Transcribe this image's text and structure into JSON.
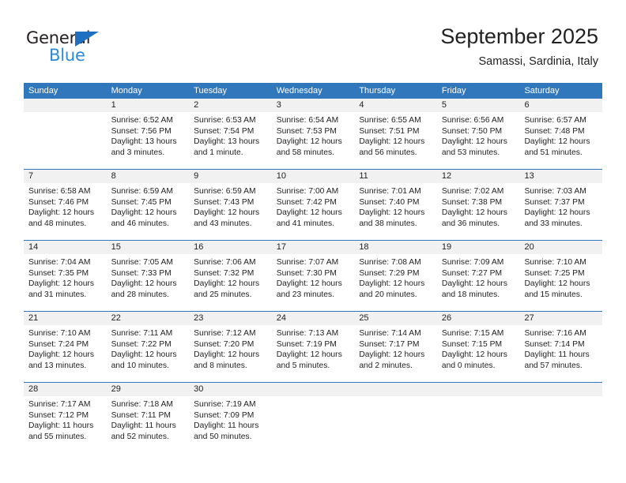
{
  "brand": {
    "name_top": "General",
    "name_bottom": "Blue",
    "triangle_icon": "triangle-icon",
    "color_dark": "#231f20",
    "color_blue": "#2e8ad6"
  },
  "header": {
    "title": "September 2025",
    "subtitle": "Samassi, Sardinia, Italy"
  },
  "theme": {
    "header_blue": "#3077bc",
    "daynum_band": "#f1f1f1",
    "text": "#222222"
  },
  "calendar": {
    "weekday_headers": [
      "Sunday",
      "Monday",
      "Tuesday",
      "Wednesday",
      "Thursday",
      "Friday",
      "Saturday"
    ],
    "labels": {
      "sunrise": "Sunrise:",
      "sunset": "Sunset:",
      "daylight": "Daylight:"
    },
    "weeks": [
      [
        {
          "day": "",
          "sunrise": "",
          "sunset": "",
          "daylight": ""
        },
        {
          "day": "1",
          "sunrise": "Sunrise: 6:52 AM",
          "sunset": "Sunset: 7:56 PM",
          "daylight": "Daylight: 13 hours and 3 minutes."
        },
        {
          "day": "2",
          "sunrise": "Sunrise: 6:53 AM",
          "sunset": "Sunset: 7:54 PM",
          "daylight": "Daylight: 13 hours and 1 minute."
        },
        {
          "day": "3",
          "sunrise": "Sunrise: 6:54 AM",
          "sunset": "Sunset: 7:53 PM",
          "daylight": "Daylight: 12 hours and 58 minutes."
        },
        {
          "day": "4",
          "sunrise": "Sunrise: 6:55 AM",
          "sunset": "Sunset: 7:51 PM",
          "daylight": "Daylight: 12 hours and 56 minutes."
        },
        {
          "day": "5",
          "sunrise": "Sunrise: 6:56 AM",
          "sunset": "Sunset: 7:50 PM",
          "daylight": "Daylight: 12 hours and 53 minutes."
        },
        {
          "day": "6",
          "sunrise": "Sunrise: 6:57 AM",
          "sunset": "Sunset: 7:48 PM",
          "daylight": "Daylight: 12 hours and 51 minutes."
        }
      ],
      [
        {
          "day": "7",
          "sunrise": "Sunrise: 6:58 AM",
          "sunset": "Sunset: 7:46 PM",
          "daylight": "Daylight: 12 hours and 48 minutes."
        },
        {
          "day": "8",
          "sunrise": "Sunrise: 6:59 AM",
          "sunset": "Sunset: 7:45 PM",
          "daylight": "Daylight: 12 hours and 46 minutes."
        },
        {
          "day": "9",
          "sunrise": "Sunrise: 6:59 AM",
          "sunset": "Sunset: 7:43 PM",
          "daylight": "Daylight: 12 hours and 43 minutes."
        },
        {
          "day": "10",
          "sunrise": "Sunrise: 7:00 AM",
          "sunset": "Sunset: 7:42 PM",
          "daylight": "Daylight: 12 hours and 41 minutes."
        },
        {
          "day": "11",
          "sunrise": "Sunrise: 7:01 AM",
          "sunset": "Sunset: 7:40 PM",
          "daylight": "Daylight: 12 hours and 38 minutes."
        },
        {
          "day": "12",
          "sunrise": "Sunrise: 7:02 AM",
          "sunset": "Sunset: 7:38 PM",
          "daylight": "Daylight: 12 hours and 36 minutes."
        },
        {
          "day": "13",
          "sunrise": "Sunrise: 7:03 AM",
          "sunset": "Sunset: 7:37 PM",
          "daylight": "Daylight: 12 hours and 33 minutes."
        }
      ],
      [
        {
          "day": "14",
          "sunrise": "Sunrise: 7:04 AM",
          "sunset": "Sunset: 7:35 PM",
          "daylight": "Daylight: 12 hours and 31 minutes."
        },
        {
          "day": "15",
          "sunrise": "Sunrise: 7:05 AM",
          "sunset": "Sunset: 7:33 PM",
          "daylight": "Daylight: 12 hours and 28 minutes."
        },
        {
          "day": "16",
          "sunrise": "Sunrise: 7:06 AM",
          "sunset": "Sunset: 7:32 PM",
          "daylight": "Daylight: 12 hours and 25 minutes."
        },
        {
          "day": "17",
          "sunrise": "Sunrise: 7:07 AM",
          "sunset": "Sunset: 7:30 PM",
          "daylight": "Daylight: 12 hours and 23 minutes."
        },
        {
          "day": "18",
          "sunrise": "Sunrise: 7:08 AM",
          "sunset": "Sunset: 7:29 PM",
          "daylight": "Daylight: 12 hours and 20 minutes."
        },
        {
          "day": "19",
          "sunrise": "Sunrise: 7:09 AM",
          "sunset": "Sunset: 7:27 PM",
          "daylight": "Daylight: 12 hours and 18 minutes."
        },
        {
          "day": "20",
          "sunrise": "Sunrise: 7:10 AM",
          "sunset": "Sunset: 7:25 PM",
          "daylight": "Daylight: 12 hours and 15 minutes."
        }
      ],
      [
        {
          "day": "21",
          "sunrise": "Sunrise: 7:10 AM",
          "sunset": "Sunset: 7:24 PM",
          "daylight": "Daylight: 12 hours and 13 minutes."
        },
        {
          "day": "22",
          "sunrise": "Sunrise: 7:11 AM",
          "sunset": "Sunset: 7:22 PM",
          "daylight": "Daylight: 12 hours and 10 minutes."
        },
        {
          "day": "23",
          "sunrise": "Sunrise: 7:12 AM",
          "sunset": "Sunset: 7:20 PM",
          "daylight": "Daylight: 12 hours and 8 minutes."
        },
        {
          "day": "24",
          "sunrise": "Sunrise: 7:13 AM",
          "sunset": "Sunset: 7:19 PM",
          "daylight": "Daylight: 12 hours and 5 minutes."
        },
        {
          "day": "25",
          "sunrise": "Sunrise: 7:14 AM",
          "sunset": "Sunset: 7:17 PM",
          "daylight": "Daylight: 12 hours and 2 minutes."
        },
        {
          "day": "26",
          "sunrise": "Sunrise: 7:15 AM",
          "sunset": "Sunset: 7:15 PM",
          "daylight": "Daylight: 12 hours and 0 minutes."
        },
        {
          "day": "27",
          "sunrise": "Sunrise: 7:16 AM",
          "sunset": "Sunset: 7:14 PM",
          "daylight": "Daylight: 11 hours and 57 minutes."
        }
      ],
      [
        {
          "day": "28",
          "sunrise": "Sunrise: 7:17 AM",
          "sunset": "Sunset: 7:12 PM",
          "daylight": "Daylight: 11 hours and 55 minutes."
        },
        {
          "day": "29",
          "sunrise": "Sunrise: 7:18 AM",
          "sunset": "Sunset: 7:11 PM",
          "daylight": "Daylight: 11 hours and 52 minutes."
        },
        {
          "day": "30",
          "sunrise": "Sunrise: 7:19 AM",
          "sunset": "Sunset: 7:09 PM",
          "daylight": "Daylight: 11 hours and 50 minutes."
        },
        {
          "day": "",
          "sunrise": "",
          "sunset": "",
          "daylight": ""
        },
        {
          "day": "",
          "sunrise": "",
          "sunset": "",
          "daylight": ""
        },
        {
          "day": "",
          "sunrise": "",
          "sunset": "",
          "daylight": ""
        },
        {
          "day": "",
          "sunrise": "",
          "sunset": "",
          "daylight": ""
        }
      ]
    ]
  }
}
